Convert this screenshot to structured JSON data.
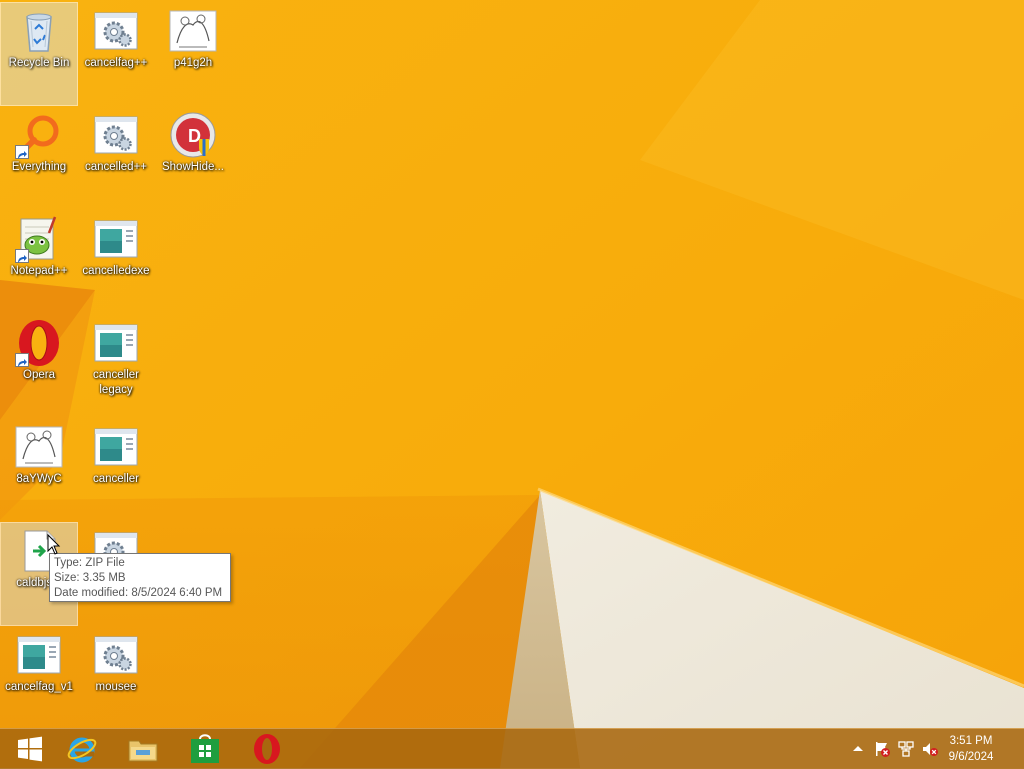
{
  "colors": {
    "wallpaper_base": "#F7AB0C",
    "wallpaper_dark": "#E07A08",
    "wallpaper_light": "#FBC53A",
    "wallpaper_white": "#EEE8DB",
    "taskbar": "#A8680E"
  },
  "desktop": {
    "icons": [
      {
        "label": "Recycle Bin",
        "icon": "recycle-bin-icon",
        "shortcut": false,
        "selected": true
      },
      {
        "label": "cancelfag++",
        "icon": "gear-app-icon",
        "shortcut": false
      },
      {
        "label": "p41g2h",
        "icon": "image-thumbnail-icon",
        "shortcut": false
      },
      {
        "label": "Everything",
        "icon": "magnifier-icon",
        "shortcut": true
      },
      {
        "label": "cancelled++",
        "icon": "gear-app-icon",
        "shortcut": false
      },
      {
        "label": "ShowHide...",
        "icon": "showhide-shield-icon",
        "shortcut": false
      },
      {
        "label": "Notepad++",
        "icon": "notepad-plus-plus-icon",
        "shortcut": true
      },
      {
        "label": "cancelledexe",
        "icon": "window-app-icon",
        "shortcut": false
      },
      {
        "label": "Opera",
        "icon": "opera-icon",
        "shortcut": true
      },
      {
        "label": "canceller legacy",
        "icon": "window-app-icon",
        "shortcut": false
      },
      {
        "label": "8aYWyC",
        "icon": "image-thumbnail-icon",
        "shortcut": false
      },
      {
        "label": "canceller",
        "icon": "window-app-icon",
        "shortcut": false
      },
      {
        "label": "caldbjs...",
        "icon": "zip-file-icon",
        "shortcut": false,
        "selected": true
      },
      {
        "label": "",
        "icon": "gear-app-icon",
        "shortcut": false
      },
      {
        "label": "cancelfag_v1",
        "icon": "window-app-icon",
        "shortcut": false
      },
      {
        "label": "mousee",
        "icon": "gear-app-icon",
        "shortcut": false
      }
    ]
  },
  "tooltip": {
    "type_line": "Type: ZIP File",
    "size_line": "Size: 3.35 MB",
    "date_line": "Date modified: 8/5/2024 6:40 PM"
  },
  "taskbar": {
    "pinned": [
      {
        "name": "start-button",
        "icon": "windows-logo-icon"
      },
      {
        "name": "internet-explorer",
        "icon": "internet-explorer-icon"
      },
      {
        "name": "file-explorer",
        "icon": "folder-icon"
      },
      {
        "name": "store",
        "icon": "store-icon"
      },
      {
        "name": "opera",
        "icon": "opera-icon"
      }
    ],
    "tray_icons": [
      "show-hidden-icons-chevron-icon",
      "action-center-flag-icon",
      "network-icon",
      "volume-muted-icon"
    ],
    "clock": {
      "time": "3:51 PM",
      "date": "9/6/2024"
    }
  }
}
